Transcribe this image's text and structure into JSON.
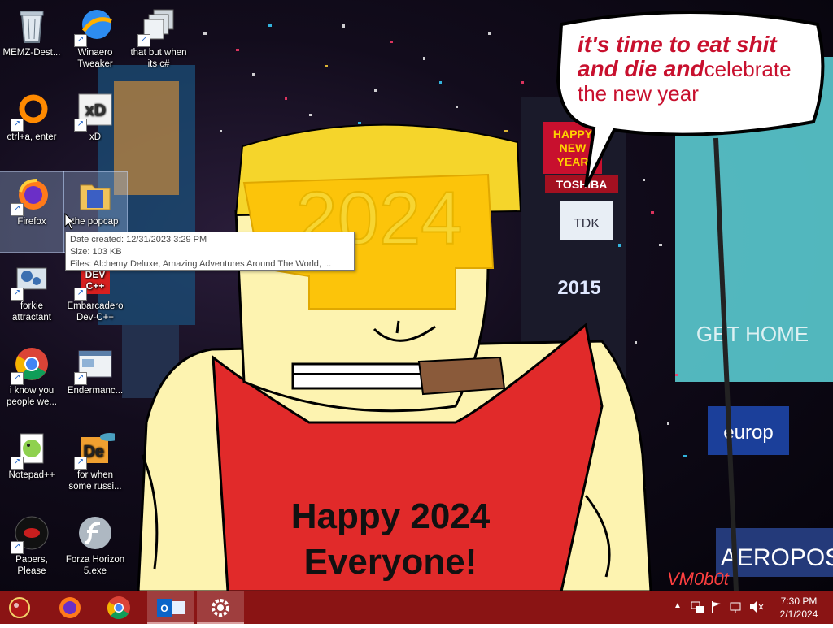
{
  "desktop": {
    "icons": [
      {
        "label": "MEMZ-Dest...",
        "icon": "recycle-bin-icon"
      },
      {
        "label": "Winaero Tweaker",
        "icon": "winaero-icon"
      },
      {
        "label": "that but when its c#",
        "icon": "stacked-windows-icon"
      },
      {
        "label": "ctrl+a, enter",
        "icon": "orange-ring-icon"
      },
      {
        "label": "xD",
        "icon": "hxd-icon"
      },
      {
        "label": "Firefox",
        "icon": "firefox-icon"
      },
      {
        "label": "the popcap",
        "icon": "folder-icon"
      },
      {
        "label": "forkie attractant",
        "icon": "gear-monitor-icon"
      },
      {
        "label": "Embarcadero Dev-C++",
        "icon": "devcpp-icon"
      },
      {
        "label": "i know you people we...",
        "icon": "chrome-icon"
      },
      {
        "label": "Endermanc...",
        "icon": "window-app-icon"
      },
      {
        "label": "Notepad++",
        "icon": "notepadpp-icon"
      },
      {
        "label": "for when some russi...",
        "icon": "de-fish-icon"
      },
      {
        "label": "Papers, Please",
        "icon": "papers-please-icon"
      },
      {
        "label": "Forza Horizon 5.exe",
        "icon": "flash-icon"
      }
    ]
  },
  "tooltip": {
    "date_created": "Date created: 12/31/2023 3:29 PM",
    "size": "Size: 103 KB",
    "files": "Files: Alchemy Deluxe, Amazing Adventures Around The World, ..."
  },
  "wallpaper": {
    "year_text": "2024",
    "speech_line1": "it's time to eat shit",
    "speech_line2": "and die and",
    "speech_line2b": "celebrate",
    "speech_line3": "the new year",
    "greeting_line1": "Happy 2024",
    "greeting_line2": "Everyone!",
    "billboard_happy": "HAPPY",
    "billboard_new": "NEW",
    "billboard_year": "YEAR",
    "billboard_toshiba": "TOSHIBA",
    "billboard_tdk": "TDK",
    "billboard_2015": "2015",
    "billboard_get_home": "GET HOME",
    "billboard_aero": "AEROPOS",
    "billboard_euro": "europ",
    "watermark": "VM0b0t"
  },
  "taskbar": {
    "buttons": [
      {
        "name": "start",
        "icon": "start-orb-icon"
      },
      {
        "name": "firefox",
        "icon": "firefox-icon"
      },
      {
        "name": "chrome",
        "icon": "chrome-icon"
      },
      {
        "name": "outlook",
        "icon": "outlook-icon"
      },
      {
        "name": "settings",
        "icon": "gear-icon"
      }
    ],
    "clock": {
      "time": "7:30 PM",
      "date": "2/1/2024"
    }
  },
  "colors": {
    "taskbar": "#8a1414",
    "speech_text": "#c8102e",
    "tooltip_border": "#767676"
  }
}
